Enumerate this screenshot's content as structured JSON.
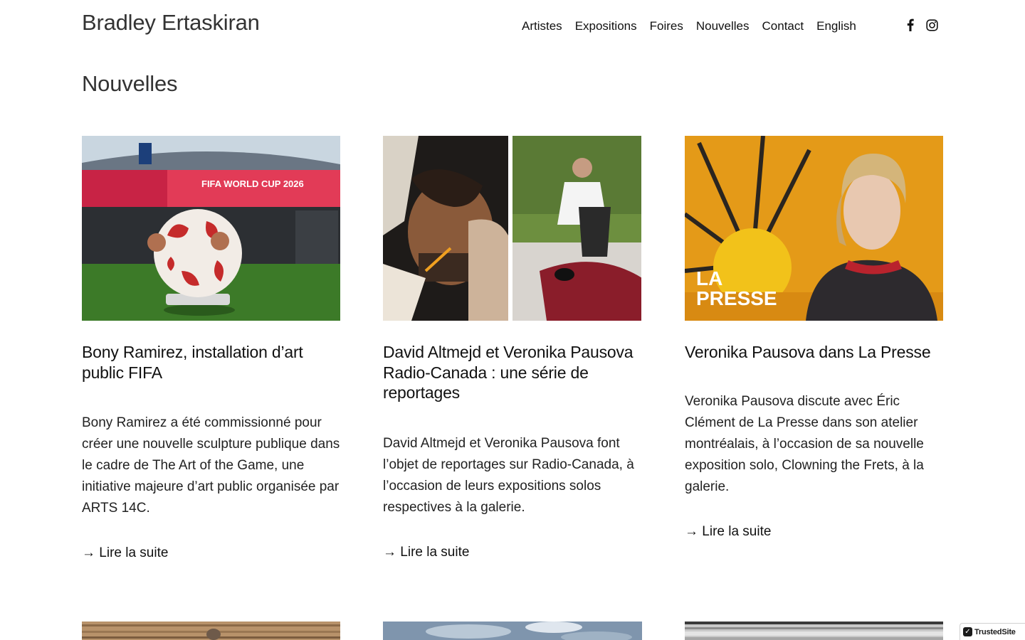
{
  "header": {
    "brand": "Bradley Ertaskiran",
    "nav": [
      "Artistes",
      "Expositions",
      "Foires",
      "Nouvelles",
      "Contact",
      "English"
    ],
    "social": [
      {
        "icon": "facebook-icon"
      },
      {
        "icon": "instagram-icon"
      }
    ]
  },
  "page": {
    "title": "Nouvelles"
  },
  "articles": [
    {
      "title": "Bony Ramirez, installation d’art public FIFA",
      "excerpt": "Bony Ramirez a été commissionné pour créer une nouvelle sculpture publique dans le cadre de The Art of the Game, une initiative majeure d’art public organisée par ARTS 14C.",
      "read_more": "→ Lire la suite",
      "image_text": "FIFA WORLD CUP 2026"
    },
    {
      "title": "David Altmejd et Veronika Pausova Radio-Canada : une série de reportages",
      "excerpt": "David Altmejd et Veronika Pausova font l’objet de reportages sur Radio-Canada, à l’occasion de leurs expositions solos respectives à la galerie.",
      "read_more": "→ Lire la suite"
    },
    {
      "title": "Veronika Pausova dans La Presse",
      "excerpt": "Veronika Pausova discute avec Éric Clément de La Presse dans son atelier montréalais, à l’occasion de sa nouvelle exposition solo, Clowning the Frets, à la galerie.",
      "read_more": "→ Lire la suite",
      "image_text": [
        "LA",
        "PRESSE"
      ]
    }
  ],
  "badge": {
    "label": "TrustedSite",
    "check": "✓"
  }
}
